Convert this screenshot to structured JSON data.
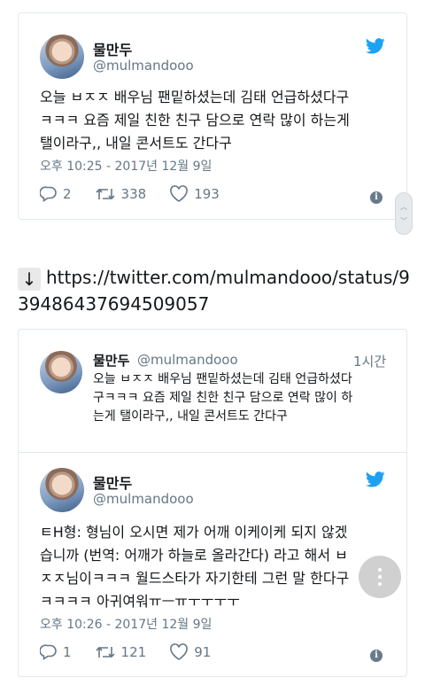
{
  "tweet1": {
    "name": "물만두",
    "handle": "@mulmandooo",
    "text_lines": [
      "오늘 ㅂㅈㅈ 배우님 팬밑하셨는데 김태 언급하셨다구",
      "ㅋㅋㅋ 요즘 제일 친한 친구 담으로 연락 많이 하는게",
      "탤이라구,, 내일 콘서트도 간다구"
    ],
    "timestamp": "오후 10:25 - 2017년 12월 9일",
    "replies": "2",
    "retweets": "338",
    "likes": "193"
  },
  "link_line": "https://twitter.com/mulmandooo/status/939486437694509057",
  "link_line_parts": [
    "https://twitter.com/mulmandooo/status/9",
    "39486437694509057"
  ],
  "arrow_glyph": "↓",
  "quoted": {
    "name": "물만두",
    "handle": "@mulmandooo",
    "relative_time": "1시간",
    "text_lines": [
      "오늘 ㅂㅈㅈ 배우님 팬밑하셨는데 김태 언급하셨다",
      "구ㅋㅋㅋ 요즘 제일 친한 친구 담으로 연락 많이 하",
      "는게 탤이라구,, 내일 콘서트도 간다구"
    ]
  },
  "tweet2": {
    "name": "물만두",
    "handle": "@mulmandooo",
    "text_lines": [
      "ㅌH형: 형님이 오시면 제가 어깨 이케이케 되지 않겠",
      "습니까 (번역: 어깨가 하늘로 올라간다) 라고 해서 ㅂ",
      "ㅈㅈ님이ㅋㅋㅋ 월드스타가 자기한테 그런 말 한다구",
      "ㅋㅋㅋㅋ 아귀여워ㅠㅡㅠㅜㅜㅜㅜ"
    ],
    "timestamp": "오후 10:26 - 2017년 12월 9일",
    "replies": "1",
    "retweets": "121",
    "likes": "91"
  },
  "colors": {
    "twitter_blue": "#1da1f2",
    "meta_gray": "#657786",
    "border": "#e1e8ed"
  },
  "icons": [
    "twitter-bird-icon",
    "reply-icon",
    "retweet-icon",
    "like-icon",
    "info-icon",
    "more-vertical-icon"
  ]
}
